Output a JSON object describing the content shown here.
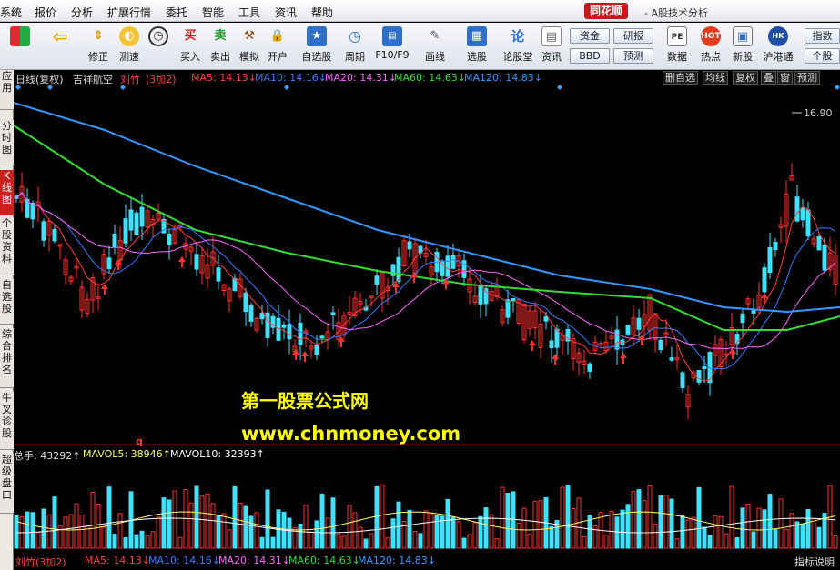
{
  "menu": [
    "系统",
    "报价",
    "分析",
    "扩展行情",
    "委托",
    "智能",
    "工具",
    "资讯",
    "帮助"
  ],
  "brand": "同花顺",
  "app_title": "- A股技术分析",
  "toolbar": {
    "items": [
      {
        "label": "",
        "icon": "layout-grid-icon"
      },
      {
        "label": "",
        "icon": "back-arrow-icon"
      },
      {
        "label": "修正",
        "icon": "adjust-icon"
      },
      {
        "label": "测速",
        "icon": "speed-test-icon"
      },
      {
        "label": "买入",
        "icon": "buy-icon",
        "glyph": "买"
      },
      {
        "label": "卖出",
        "icon": "sell-icon",
        "glyph": "卖"
      },
      {
        "label": "模拟",
        "icon": "gavel-icon"
      },
      {
        "label": "开户",
        "icon": "lock-icon"
      },
      {
        "label": "自选股",
        "icon": "star-list-icon"
      },
      {
        "label": "周期",
        "icon": "clock-icon"
      },
      {
        "label": "F10/F9",
        "icon": "f10-icon"
      },
      {
        "label": "画线",
        "icon": "pencil-icon"
      },
      {
        "label": "选股",
        "icon": "chart-select-icon"
      },
      {
        "label": "论股堂",
        "icon": "discuss-icon"
      },
      {
        "label": "资讯",
        "icon": "news-icon"
      },
      {
        "label": "数据",
        "icon": "pe-data-icon"
      },
      {
        "label": "热点",
        "icon": "hot-icon"
      },
      {
        "label": "新股",
        "icon": "new-stock-icon"
      },
      {
        "label": "沪港通",
        "icon": "sse-hk-icon"
      }
    ],
    "small_buttons": [
      "资金",
      "研报",
      "BBD",
      "预测"
    ],
    "right_buttons": [
      "指数",
      "个股"
    ]
  },
  "left_tabs": [
    "应用",
    "分时图",
    "K线图",
    "个股资料",
    "自选股",
    "综合排名",
    "牛叉诊股",
    "超级盘口"
  ],
  "chart_header": {
    "period": "日线(复权)",
    "stock": "吉祥航空",
    "formula": "刘竹",
    "formula_param": "(3加2)",
    "ma": [
      {
        "label": "MA5: 14.13↓",
        "color": "#ff4040"
      },
      {
        "label": "MA10: 14.16↓",
        "color": "#3a7bff"
      },
      {
        "label": "MA20: 14.31↓",
        "color": "#ff66ff"
      },
      {
        "label": "MA60: 14.63↓",
        "color": "#33dd33"
      },
      {
        "label": "MA120: 14.83↓",
        "color": "#3399ff"
      }
    ]
  },
  "right_controls": [
    "删自选",
    "均线",
    "复权",
    "叠",
    "窗",
    "预测"
  ],
  "price_label": "16.90",
  "watermark": {
    "line1": "第一股票公式网",
    "line2": "www.chnmoney.com"
  },
  "volume_header": {
    "total": "总手: 43292↑",
    "mavol5": "MAVOL5: 38946↑",
    "mavol10": "MAVOL10: 32393↑",
    "marker": "q"
  },
  "bottom_line": {
    "formula": "刘竹(3加2)",
    "ma5": "MA5: 14.13↓",
    "ma10": "MA10: 14.16↓",
    "ma20": "MA20: 14.31↓",
    "ma60": "MA60: 14.63↓",
    "ma120": "MA120: 14.83↓",
    "right": "指标说明"
  },
  "colors": {
    "up": "#ff3030",
    "down": "#40e0ff",
    "ma5": "#ff4040",
    "ma10": "#3a7bff",
    "ma20": "#ff66ff",
    "ma60": "#33dd33",
    "ma120": "#3399ff"
  }
}
